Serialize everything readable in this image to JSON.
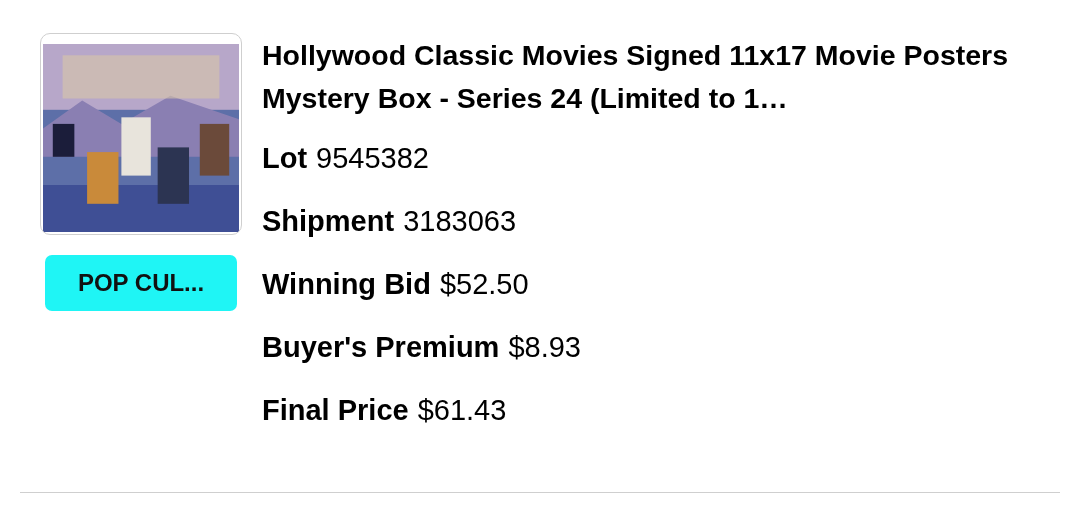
{
  "item": {
    "category_badge": "POP CUL...",
    "title": "Hollywood Classic Movies Signed 11x17 Movie Posters Mystery Box - Series 24 (Limited to 1…",
    "details": [
      {
        "label": "Lot",
        "value": "9545382"
      },
      {
        "label": "Shipment",
        "value": "3183063"
      },
      {
        "label": "Winning Bid",
        "value": "$52.50"
      },
      {
        "label": "Buyer's Premium",
        "value": "$8.93"
      },
      {
        "label": "Final Price",
        "value": "$61.43"
      }
    ]
  }
}
